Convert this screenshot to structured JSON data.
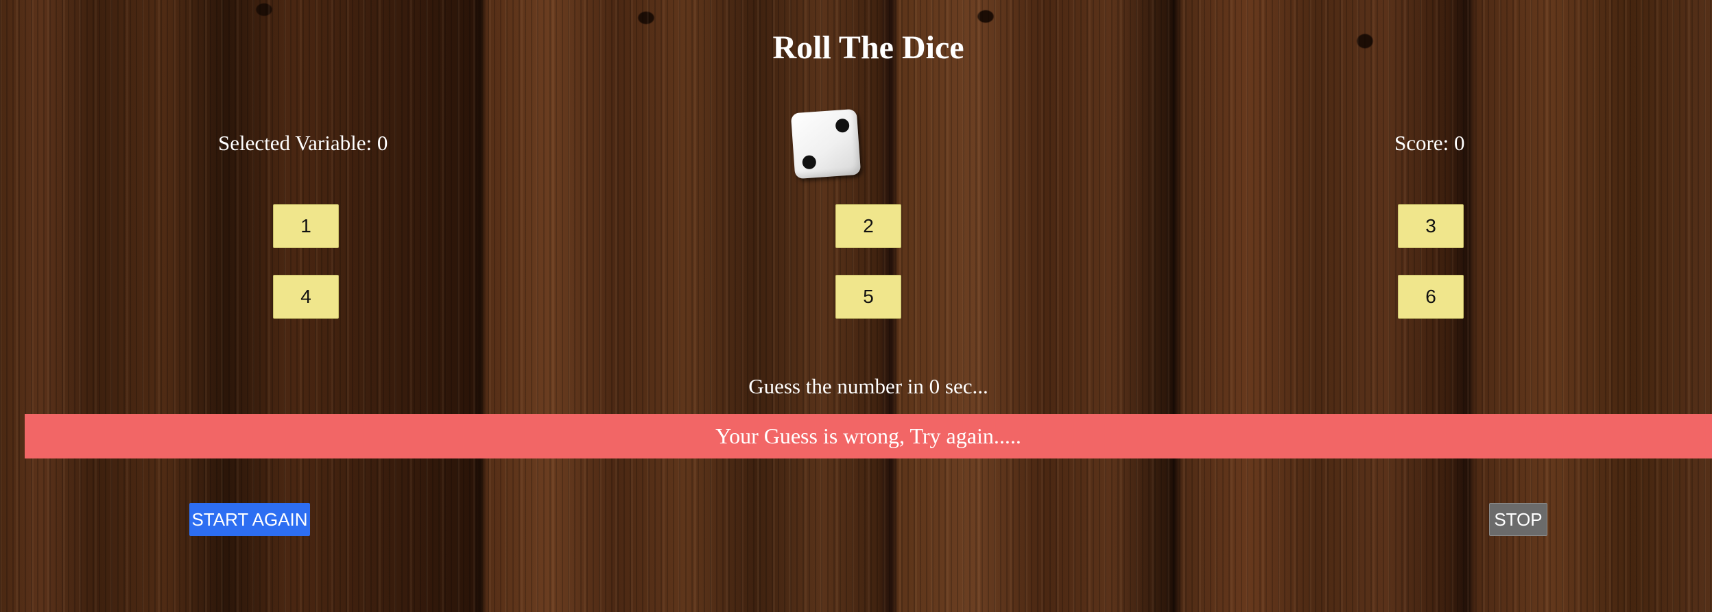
{
  "title": "Roll The Dice",
  "status": {
    "selected_variable_label": "Selected Variable: 0",
    "score_label": "Score: 0"
  },
  "die": {
    "face_value": 2,
    "icon": "dice-face-two-icon"
  },
  "number_buttons": [
    "1",
    "2",
    "3",
    "4",
    "5",
    "6"
  ],
  "timer_text": "Guess the number in 0 sec...",
  "alert_text": "Your Guess is wrong, Try again.....",
  "controls": {
    "start_again_label": "START AGAIN",
    "stop_label": "STOP"
  },
  "colors": {
    "number_button": "#f0e68c",
    "alert_background": "#f26666",
    "start_button": "#2d6ef2",
    "stop_button": "#6b6b6b",
    "text": "#ffffff"
  }
}
